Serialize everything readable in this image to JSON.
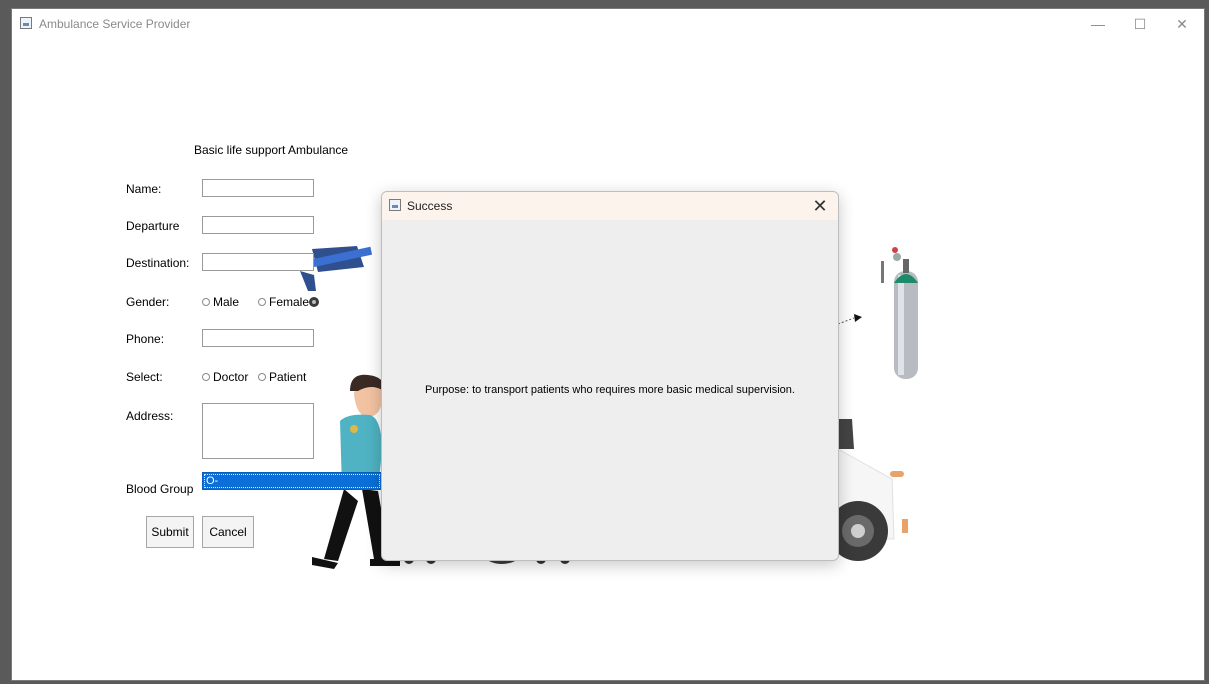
{
  "window": {
    "title": "Ambulance Service Provider",
    "minimize_glyph": "—",
    "maximize_glyph": "☐",
    "close_glyph": "✕"
  },
  "form": {
    "heading": "Basic life support Ambulance",
    "name_label": "Name:",
    "departure_label": "Departure",
    "destination_label": "Destination:",
    "gender_label": "Gender:",
    "gender_options": [
      "Male",
      "Female"
    ],
    "phone_label": "Phone:",
    "select_label": "Select:",
    "select_options": [
      "Doctor",
      "Patient"
    ],
    "address_label": "Address:",
    "blood_group_label": "Blood Group",
    "blood_group_value": "O-",
    "submit_label": "Submit",
    "cancel_label": "Cancel"
  },
  "dialog": {
    "title": "Success",
    "close_glyph": "✕",
    "message": "Purpose: to transport patients who requires more basic medical supervision."
  },
  "colors": {
    "selection_blue": "#0a6fd8",
    "dialog_title_bg": "#fbf3ec",
    "dialog_bg": "#eeeeee"
  }
}
